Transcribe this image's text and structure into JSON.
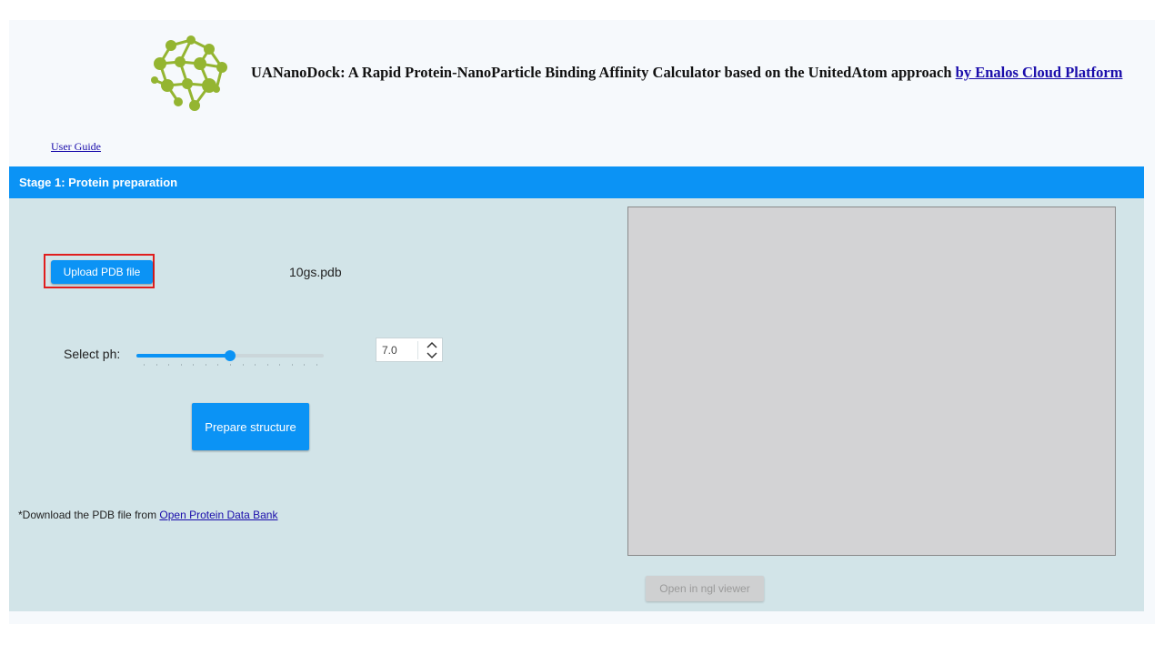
{
  "header": {
    "logo_icon": "molecule-cluster-logo-icon",
    "title_text": "UANanoDock: A Rapid Protein-NanoParticle Binding Affinity Calculator based on the UnitedAtom approach ",
    "title_link": "by Enalos Cloud Platform",
    "user_guide_link": "User Guide"
  },
  "stage1": {
    "title": "Stage 1: Protein preparation",
    "upload_label": "Upload PDB file",
    "filename": "10gs.pdb",
    "ph_label": "Select ph:",
    "ph_value": "7.0",
    "ph_fraction": 0.5,
    "prepare_label": "Prepare structure",
    "download_note": "*Download the PDB file from ",
    "download_link": "Open Protein Data Bank",
    "ngl_label": "Open in ngl viewer"
  },
  "colors": {
    "accent": "#0b93f5",
    "panel": "#d2e4e8",
    "highlight": "#e01e1e",
    "logo": "#94b531"
  }
}
